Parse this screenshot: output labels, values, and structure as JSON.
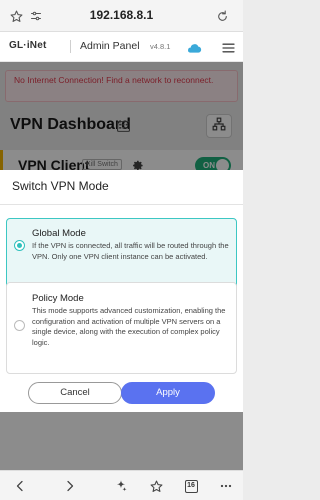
{
  "browser": {
    "url": "192.168.8.1",
    "tabs_count": "16"
  },
  "header": {
    "logo": "GL·iNet",
    "title": "Admin Panel",
    "version": "v4.8.1"
  },
  "alert": {
    "text": "No Internet Connection! Find a network to reconnect."
  },
  "dashboard": {
    "title": "VPN Dashboard",
    "vpn_client_label": "VPN Client",
    "kill_switch_badge": "Kill Switch",
    "toggle_label": "ON"
  },
  "modal": {
    "title": "Switch VPN Mode",
    "options": [
      {
        "title": "Global Mode",
        "description": "If the VPN is connected, all traffic will be routed through the VPN. Only one VPN client instance can be activated.",
        "selected": true
      },
      {
        "title": "Policy Mode",
        "description": "This mode supports advanced customization, enabling the configuration and activation of multiple VPN servers on a single device, along with the execution of complex policy logic.",
        "selected": false
      }
    ],
    "cancel_label": "Cancel",
    "apply_label": "Apply"
  },
  "colors": {
    "accent_teal": "#2fc0bc",
    "apply_blue": "#5a72f0",
    "alert_red": "#e03a4e",
    "toggle_green": "#1fb07a"
  },
  "icons": [
    "star-outline-icon",
    "settings-sliders-icon",
    "refresh-icon",
    "cloud-icon",
    "hamburger-menu-icon",
    "dashboard-grid-icon",
    "network-topology-icon",
    "gear-icon",
    "back-icon",
    "forward-icon",
    "ai-sparkle-icon",
    "star-icon",
    "tabs-icon",
    "more-icon"
  ]
}
